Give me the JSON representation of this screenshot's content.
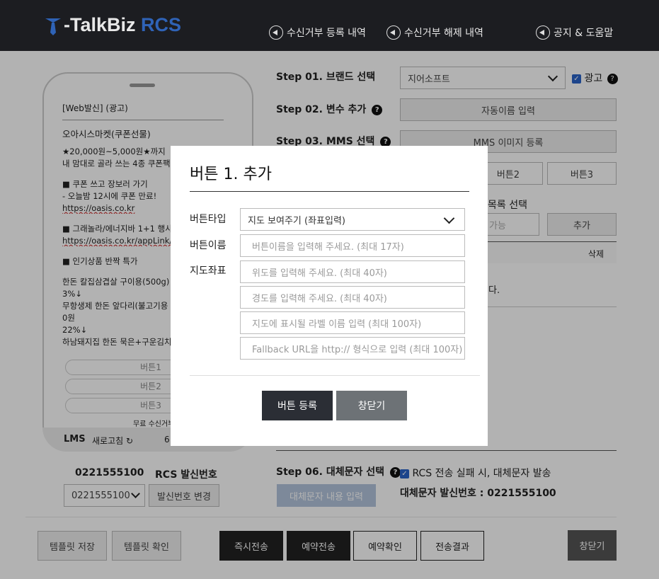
{
  "header": {
    "logo_main": "-TalkBiz",
    "logo_rcs": "RCS",
    "nav": [
      {
        "label": "수신거부 등록 내역",
        "icon": "speaker-icon"
      },
      {
        "label": "수신거부 해제 내역",
        "icon": "speaker-icon"
      },
      {
        "label": "공지 & 도움말",
        "icon": "phone-icon"
      }
    ]
  },
  "preview": {
    "header": "[Web발신] (광고)",
    "lines": [
      "오아시스마켓(쿠폰선물)",
      "★20,000원~5,000원★까지",
      "내 맘대로 골라 쓰는 4종 쿠폰팩",
      "■ 쿠폰 쓰고 장보러 가기",
      "- 오늘밤 12시에 쿠폰 만료!",
      "https://oasis.co.kr",
      "■ 그래놀라/에너지바 1+1 행사",
      "https://oasis.co.kr/appLink/",
      "■ 인기상품 반짝 특가",
      "한돈 칼집삼겹살 구이용(500g)",
      "3%↓",
      "무항생제 한돈 앞다리(불고기용",
      "0원",
      "22%↓",
      "하남돼지집 한돈 묵은+구운김치"
    ],
    "buttons": [
      "버튼1",
      "버튼2",
      "버튼3"
    ],
    "unsubscribe": "무료 수신거부",
    "lms_label": "LMS",
    "refresh_label": "새로고침",
    "count": "6"
  },
  "sender": {
    "number": "0221555100",
    "label": "RCS 발신번호",
    "select_value": "0221555100",
    "change_button": "발신번호 변경"
  },
  "steps": {
    "s1": "Step 01. 브랜드 선택",
    "brand_value": "지어소프트",
    "ad_label": "광고",
    "s2": "Step 02. 변수 추가",
    "s2_button": "자동이름 입력",
    "s3": "Step 03. MMS 선택",
    "s3_button": "MMS 이미지 등록",
    "btn2": "버튼2",
    "btn3": "버튼3",
    "list_label": "목록 선택",
    "list_placeholder": "가능",
    "add_button": "추가",
    "delete_col": "삭제",
    "empty_suffix": "다.",
    "s6": "Step 06. 대체문자 선택",
    "s6_check": "RCS 전송 실패 시, 대체문자 발송",
    "s6_input_button": "대체문자 내용 입력",
    "alt_sender_label": "대체문자 발신번호 : 0221555100"
  },
  "bottom": {
    "template_save": "템플릿 저장",
    "template_check": "템플릿 확인",
    "send_now": "즉시전송",
    "send_reserved": "예약전송",
    "reserve_check": "예약확인",
    "send_result": "전송결과",
    "close": "창닫기"
  },
  "modal": {
    "title": "버튼 1. 추가",
    "type_label": "버튼타입",
    "type_value": "지도 보여주기 (좌표입력)",
    "name_label": "버튼이름",
    "name_placeholder": "버튼이름을 입력해 주세요. (최대 17자)",
    "coord_label": "지도좌표",
    "lat_placeholder": "위도를 입력해 주세요. (최대 40자)",
    "lng_placeholder": "경도를 입력해 주세요. (최대 40자)",
    "map_label_placeholder": "지도에 표시될 라벨 이름 입력 (최대 100자)",
    "fallback_placeholder": "Fallback URL을 http:// 형식으로 입력 (최대 100자)",
    "register_button": "버튼 등록",
    "close_button": "창닫기"
  },
  "colors": {
    "header_bg": "#1c1d21",
    "accent_blue": "#2f63b7",
    "dark_button": "#2b2e35",
    "gray_button": "#6d7276"
  }
}
